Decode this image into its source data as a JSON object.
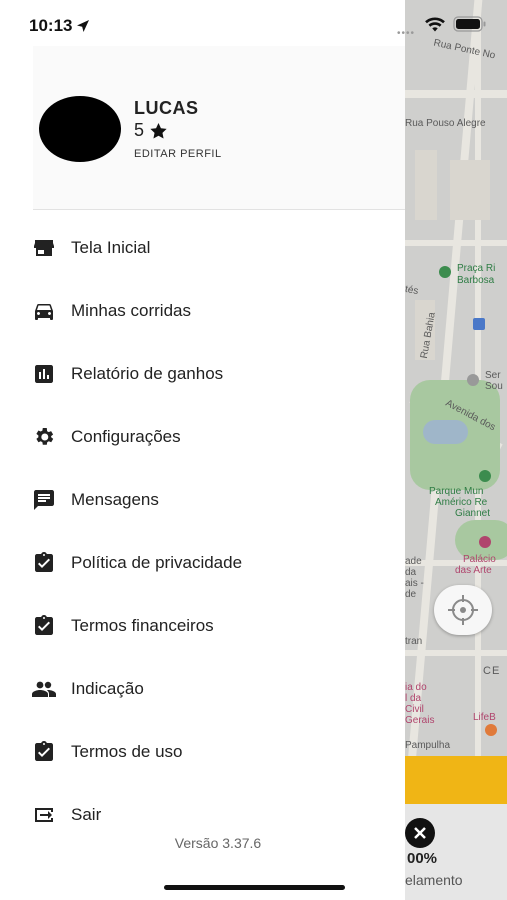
{
  "status_bar": {
    "time": "10:13"
  },
  "profile": {
    "name": "LUCAS",
    "rating": "5",
    "edit_label": "EDITAR PERFIL"
  },
  "menu": {
    "items": [
      {
        "label": "Tela Inicial",
        "icon": "store-icon"
      },
      {
        "label": "Minhas corridas",
        "icon": "car-icon"
      },
      {
        "label": "Relatório de ganhos",
        "icon": "bar-chart-icon"
      },
      {
        "label": "Configurações",
        "icon": "gear-icon"
      },
      {
        "label": "Mensagens",
        "icon": "message-icon"
      },
      {
        "label": "Política de privacidade",
        "icon": "clipboard-check-icon"
      },
      {
        "label": "Termos financeiros",
        "icon": "clipboard-check-icon"
      },
      {
        "label": "Indicação",
        "icon": "people-icon"
      },
      {
        "label": "Termos de uso",
        "icon": "clipboard-check-icon"
      },
      {
        "label": "Sair",
        "icon": "logout-icon"
      }
    ]
  },
  "version": "Versão 3.37.6",
  "map": {
    "labels": [
      "Rua Ponte No",
      "Rua Pouso Alegre",
      "Praça Ri",
      "Barbosa",
      "tés",
      "Rua Bahia",
      "Ser",
      "Sou",
      "Avenida dos",
      "Parque Mun",
      "Américo Re",
      "Giannet",
      "Palácio",
      "das Arte",
      "ade",
      "da",
      "ais -",
      "de",
      "tran",
      "CE",
      "ia do",
      "l da",
      "Civil",
      "Gerais",
      "LifeB",
      "Pampulha"
    ],
    "percent": "00%",
    "cancel_text": "elamento"
  },
  "colors": {
    "accent": "#f0b515",
    "map": "#cfcfcd"
  }
}
